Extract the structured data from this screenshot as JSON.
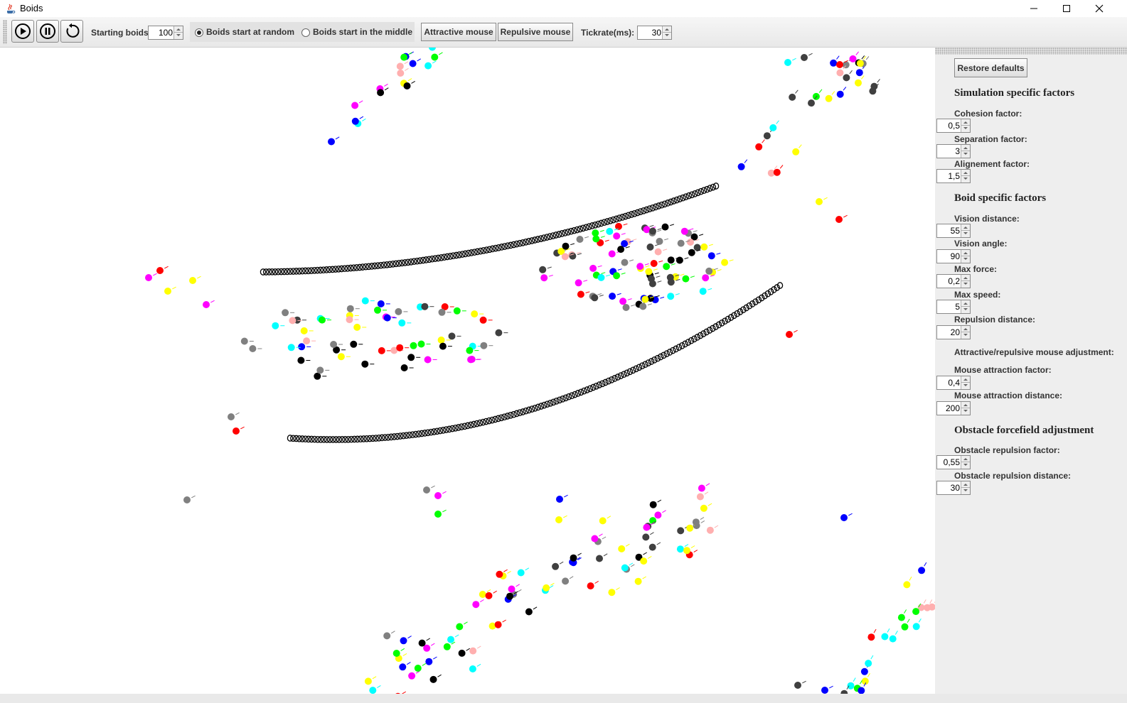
{
  "window": {
    "title": "Boids"
  },
  "toolbar": {
    "play_icon": "play-icon",
    "pause_icon": "pause-icon",
    "restart_icon": "restart-icon",
    "starting_boids_label": "Starting boids:",
    "starting_boids_value": "100",
    "start_random_label": "Boids start at random",
    "start_middle_label": "Boids start in the middle",
    "selected_start": "random",
    "attractive_mouse_label": "Attractive mouse",
    "repulsive_mouse_label": "Repulsive mouse",
    "tickrate_label": "Tickrate(ms):",
    "tickrate_value": "30"
  },
  "panel": {
    "restore_label": "Restore defaults",
    "simulation_heading": "Simulation specific factors",
    "cohesion_label": "Cohesion factor:",
    "cohesion_value": "0,5",
    "separation_label": "Separation factor:",
    "separation_value": "3",
    "alignement_label": "Alignement factor:",
    "alignement_value": "1,5",
    "boid_heading": "Boid specific factors",
    "vision_distance_label": "Vision distance:",
    "vision_distance_value": "55",
    "vision_angle_label": "Vision angle:",
    "vision_angle_value": "90",
    "max_force_label": "Max force:",
    "max_force_value": "0,2",
    "max_speed_label": "Max speed:",
    "max_speed_value": "5",
    "repulsion_distance_label": "Repulsion distance:",
    "repulsion_distance_value": "20",
    "mouse_heading": "Attractive/repulsive mouse adjustment:",
    "mouse_factor_label": "Mouse attraction factor:",
    "mouse_factor_value": "0,4",
    "mouse_distance_label": "Mouse attraction distance:",
    "mouse_distance_value": "200",
    "obstacle_heading": "Obstacle forcefield adjustment",
    "obstacle_factor_label": "Obstacle repulsion factor:",
    "obstacle_factor_value": "0,55",
    "obstacle_distance_label": "Obstacle repulsion distance:",
    "obstacle_distance_value": "30"
  },
  "simulation": {
    "colors": {
      "red": "#ff0000",
      "black": "#000000",
      "blue": "#0000ff",
      "green": "#00ff00",
      "magenta": "#ff00ff",
      "cyan": "#00ffff",
      "yellow": "#ffff00",
      "pink": "#ffafaf",
      "gray": "#808080",
      "darkgray": "#404040"
    }
  }
}
